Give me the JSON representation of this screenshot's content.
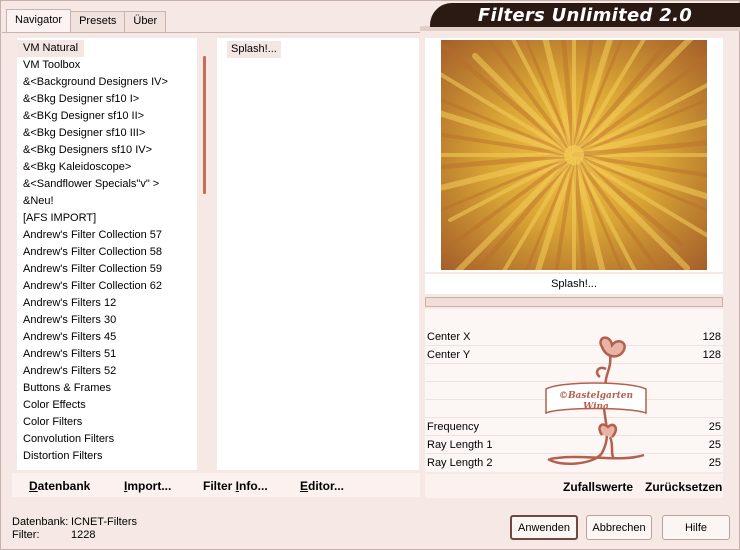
{
  "tabs": [
    {
      "label": "Navigator",
      "active": true
    },
    {
      "label": "Presets",
      "active": false
    },
    {
      "label": "Über",
      "active": false
    }
  ],
  "header": {
    "title": "Filters Unlimited 2.0"
  },
  "categories": [
    "VM Natural",
    "VM Toolbox",
    "&<Background Designers IV>",
    "&<Bkg Designer sf10 I>",
    "&<BKg Designer sf10 II>",
    "&<Bkg Designer sf10 III>",
    "&<Bkg Designers sf10 IV>",
    "&<Bkg Kaleidoscope>",
    "&<Sandflower Specials\"v\" >",
    "&Neu!",
    "[AFS IMPORT]",
    "Andrew's Filter Collection 57",
    "Andrew's Filter Collection 58",
    "Andrew's Filter Collection 59",
    "Andrew's Filter Collection 62",
    "Andrew's Filters 12",
    "Andrew's Filters 30",
    "Andrew's Filters 45",
    "Andrew's Filters 51",
    "Andrew's Filters 52",
    "Buttons & Frames",
    "Color Effects",
    "Color Filters",
    "Convolution Filters",
    "Distortion Filters"
  ],
  "selected_category": "VM Natural",
  "filters": [
    "Splash!..."
  ],
  "selected_filter": "Splash!...",
  "buttons_left": {
    "datenbank": {
      "u": "D",
      "rest": "atenbank"
    },
    "import": {
      "u": "I",
      "rest": "mport..."
    },
    "filter_info": {
      "pre": "Filter ",
      "u": "I",
      "rest": "nfo..."
    },
    "editor": {
      "u": "E",
      "rest": "ditor..."
    }
  },
  "preview": {
    "filter_name": "Splash!..."
  },
  "params": [
    {
      "label": "Center X",
      "value": "128"
    },
    {
      "label": "Center Y",
      "value": "128"
    },
    {
      "label": "Frequency",
      "value": "25"
    },
    {
      "label": "Ray Length 1",
      "value": "25"
    },
    {
      "label": "Ray Length 2",
      "value": "25"
    }
  ],
  "buttons_right": {
    "random": "Zufallswerte",
    "reset": "Zurücksetzen"
  },
  "watermark": {
    "line1": "©Bastelgarten",
    "line2": "Wina"
  },
  "status": {
    "db_label": "Datenbank:",
    "db_value": "ICNET-Filters",
    "filter_label": "Filter:",
    "filter_value": "1228"
  },
  "dialog_buttons": {
    "apply": "Anwenden",
    "cancel": "Abbrechen",
    "help": "Hilfe"
  },
  "colors": {
    "header_bg": "#2b1a14",
    "scroll_thumb": "#c86c5c",
    "preview_gold": "#d9a535",
    "preview_brown": "#a55f2a"
  }
}
